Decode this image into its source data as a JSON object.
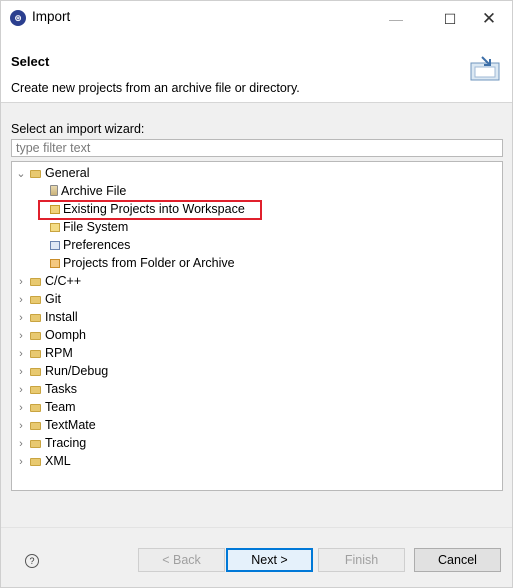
{
  "window": {
    "title": "Import",
    "app_icon_glyph": "⊛"
  },
  "header": {
    "title": "Select",
    "description": "Create new projects from an archive file or directory.",
    "image_icon": "import-wizard-icon"
  },
  "wizard": {
    "label": "Select an import wizard:",
    "filter_placeholder": "type filter text",
    "tree": [
      {
        "label": "General",
        "expanded": true,
        "children": [
          {
            "label": "Archive File",
            "icon": "archive-file-icon"
          },
          {
            "label": "Existing Projects into Workspace",
            "icon": "existing-projects-icon",
            "selected": true
          },
          {
            "label": "File System",
            "icon": "file-system-icon"
          },
          {
            "label": "Preferences",
            "icon": "preferences-icon"
          },
          {
            "label": "Projects from Folder or Archive",
            "icon": "projects-folder-icon"
          }
        ]
      },
      {
        "label": "C/C++"
      },
      {
        "label": "Git"
      },
      {
        "label": "Install"
      },
      {
        "label": "Oomph"
      },
      {
        "label": "RPM"
      },
      {
        "label": "Run/Debug"
      },
      {
        "label": "Tasks"
      },
      {
        "label": "Team"
      },
      {
        "label": "TextMate"
      },
      {
        "label": "Tracing"
      },
      {
        "label": "XML"
      }
    ]
  },
  "footer": {
    "help_glyph": "?",
    "back": "< Back",
    "next": "Next >",
    "finish": "Finish",
    "cancel": "Cancel"
  },
  "colors": {
    "highlight_border": "#e0202c",
    "default_button_border": "#0078d7"
  }
}
